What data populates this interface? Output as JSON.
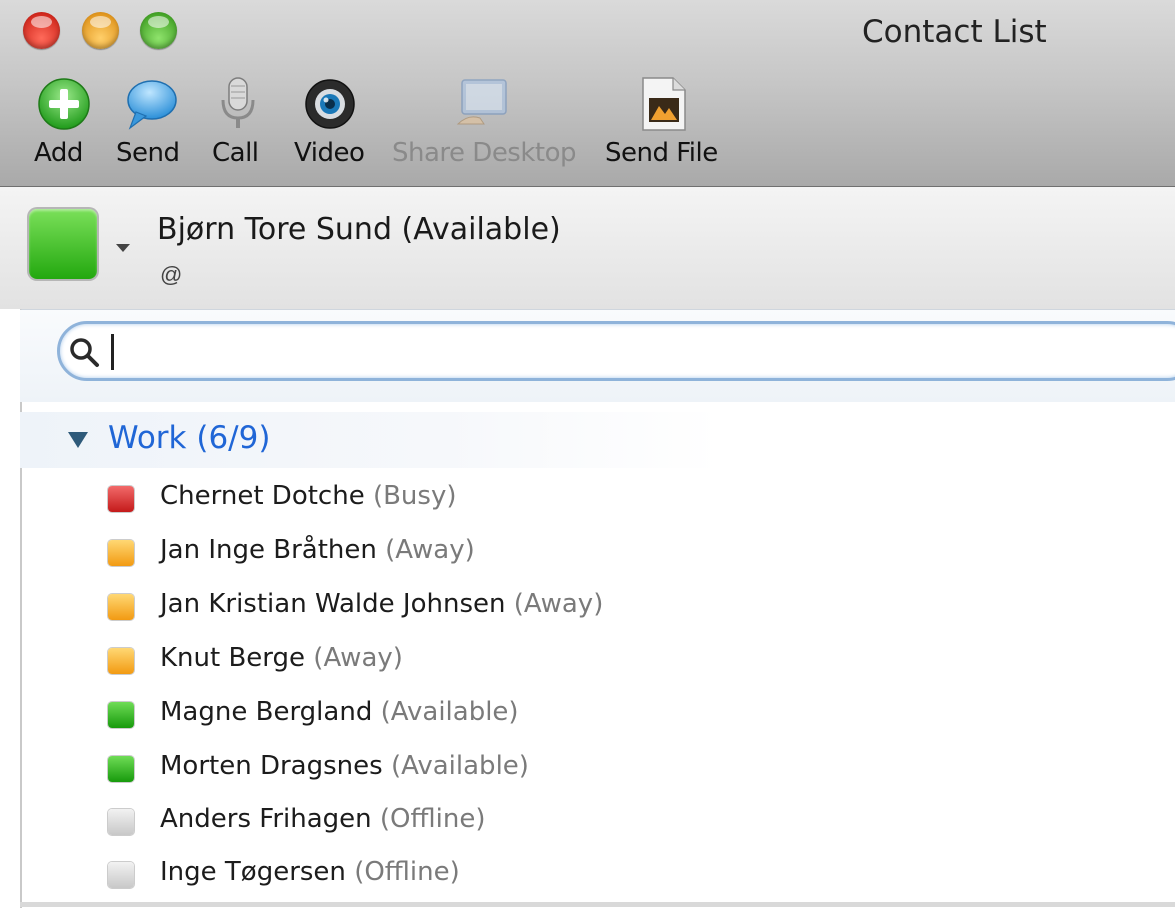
{
  "window": {
    "title": "Contact List"
  },
  "toolbar": {
    "items": [
      {
        "label": "Add",
        "icon": "add-icon",
        "enabled": true
      },
      {
        "label": "Send",
        "icon": "chat-bubble-icon",
        "enabled": true
      },
      {
        "label": "Call",
        "icon": "microphone-icon",
        "enabled": true
      },
      {
        "label": "Video",
        "icon": "webcam-icon",
        "enabled": true
      },
      {
        "label": "Share Desktop",
        "icon": "share-desktop-icon",
        "enabled": false
      },
      {
        "label": "Send File",
        "icon": "file-icon",
        "enabled": true
      }
    ]
  },
  "me": {
    "name": "Bjørn Tore Sund (Available)",
    "address": "@",
    "status_color": "#2fb41a"
  },
  "search": {
    "value": ""
  },
  "groups": [
    {
      "label": "Work (6/9)",
      "contacts": [
        {
          "name": "Chernet Dotche",
          "status": "(Busy)",
          "color": "#d8262a"
        },
        {
          "name": "Jan Inge Bråthen",
          "status": "(Away)",
          "color": "#f5a623"
        },
        {
          "name": "Jan Kristian Walde Johnsen",
          "status": "(Away)",
          "color": "#f5a623"
        },
        {
          "name": "Knut Berge",
          "status": "(Away)",
          "color": "#f5a623"
        },
        {
          "name": "Magne Bergland",
          "status": "(Available)",
          "color": "#23a80f"
        },
        {
          "name": "Morten Dragsnes",
          "status": "(Available)",
          "color": "#23a80f"
        },
        {
          "name": "Anders Frihagen",
          "status": "(Offline)",
          "color": "#cfcfcf"
        },
        {
          "name": "Inge Tøgersen",
          "status": "(Offline)",
          "color": "#cfcfcf"
        }
      ]
    }
  ]
}
